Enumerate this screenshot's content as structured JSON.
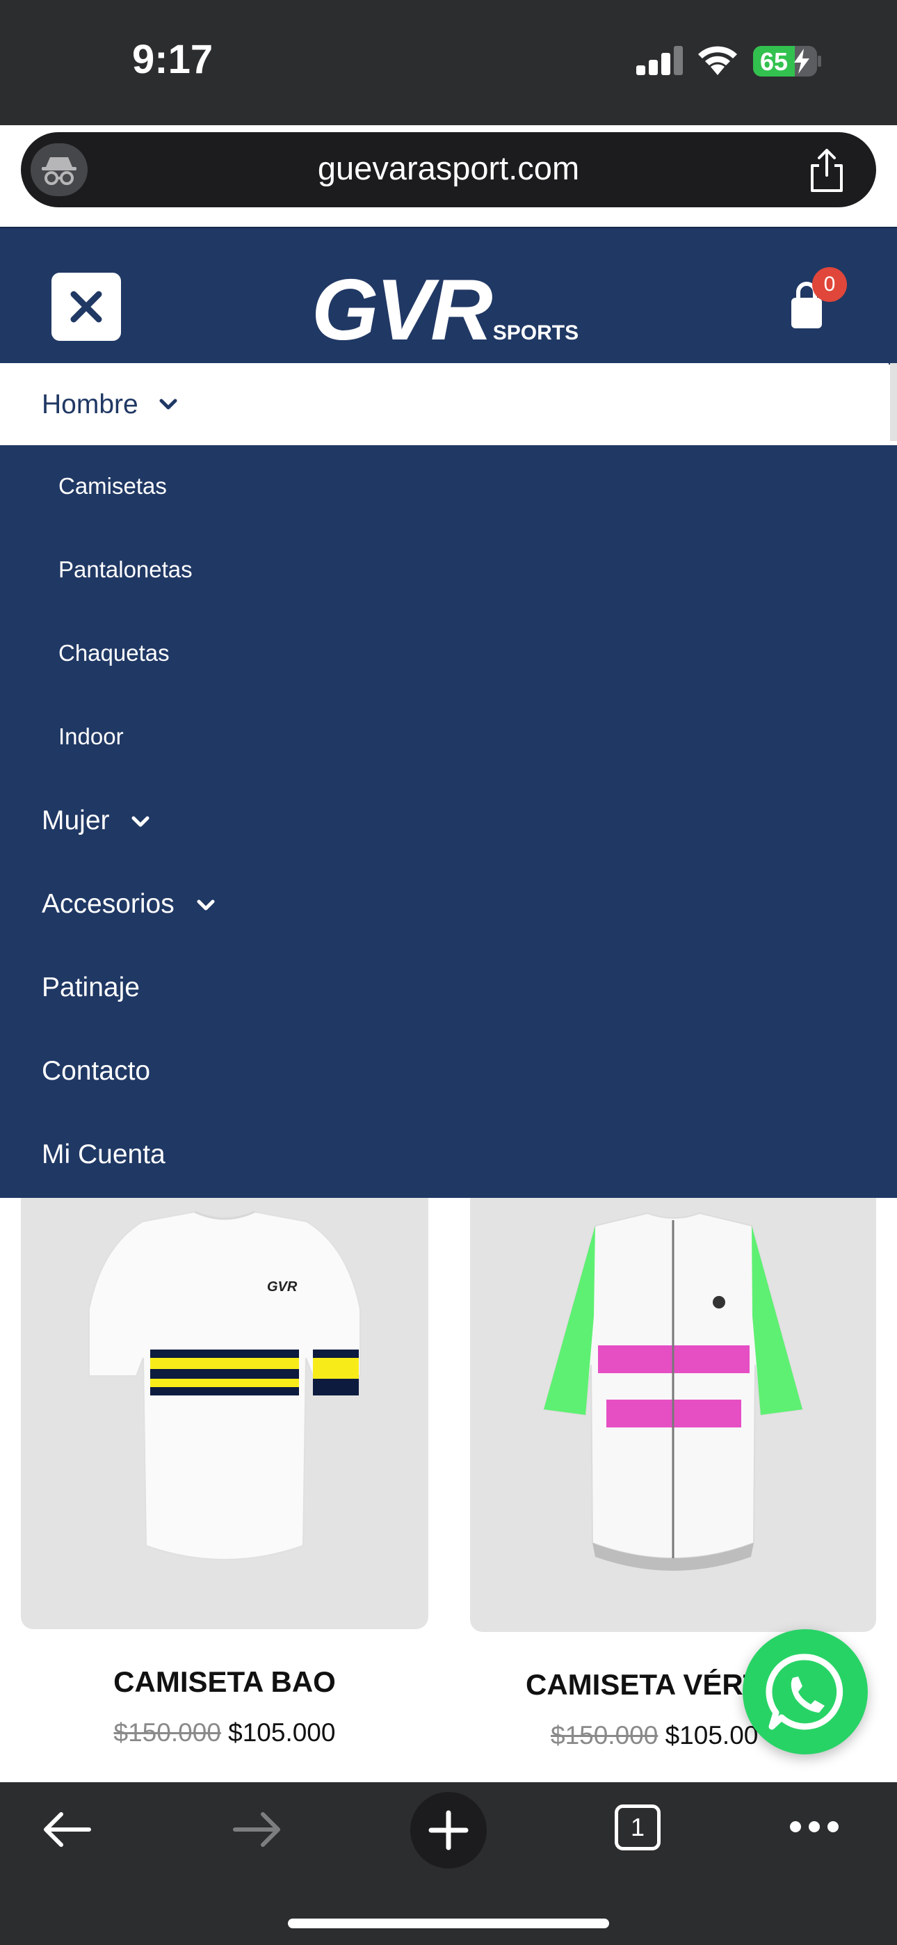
{
  "status_bar": {
    "time": "9:17",
    "battery_percent": "65",
    "battery_level": 0.65,
    "charging": true
  },
  "browser": {
    "url": "guevarasport.com"
  },
  "site": {
    "logo_text": "GVR",
    "logo_sub": "SPORTS",
    "cart_count": "0",
    "brand_color": "#203864"
  },
  "menu": {
    "hombre": "Hombre",
    "hombre_sub": [
      "Camisetas",
      "Pantalonetas",
      "Chaquetas",
      "Indoor"
    ],
    "mujer": "Mujer",
    "accesorios": "Accesorios",
    "patinaje": "Patinaje",
    "contacto": "Contacto",
    "mi_cuenta": "Mi Cuenta"
  },
  "products": [
    {
      "name": "CAMISETA BAO",
      "old_price": "$150.000",
      "price": "$105.000",
      "stripe_colors": [
        "#0d1b3e",
        "#f7ec1a"
      ]
    },
    {
      "name": "CAMISETA VÉRT",
      "old_price": "$150.000",
      "price": "$105.00",
      "stripe_colors": [
        "#e64fc4",
        "#5ef072"
      ]
    }
  ],
  "toolbar": {
    "tab_count": "1"
  },
  "icons": [
    "privacy-icon",
    "share-icon",
    "close-icon",
    "cart-icon",
    "chevron-down-icon",
    "whatsapp-icon",
    "back-arrow-icon",
    "forward-arrow-icon",
    "plus-icon",
    "tabs-icon",
    "more-icon"
  ]
}
